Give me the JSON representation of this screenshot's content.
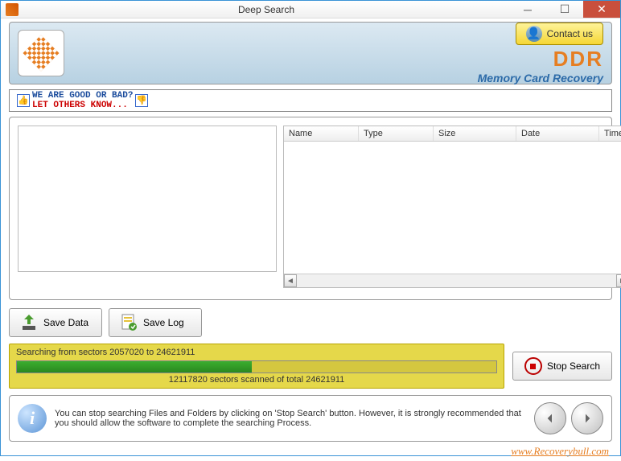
{
  "window": {
    "title": "Deep Search"
  },
  "header": {
    "contact_label": "Contact us",
    "brand": "DDR",
    "subtitle": "Memory Card Recovery"
  },
  "feedback": {
    "line1": "WE ARE GOOD OR BAD?",
    "line2": "LET OTHERS KNOW..."
  },
  "table": {
    "columns": [
      "Name",
      "Type",
      "Size",
      "Date",
      "Time"
    ]
  },
  "actions": {
    "save_data": "Save Data",
    "save_log": "Save Log",
    "stop_search": "Stop Search"
  },
  "progress": {
    "searching_line": "Searching from sectors  2057020 to 24621911",
    "scanned_line": "12117820  sectors scanned of total 24621911",
    "percent": 49
  },
  "info": {
    "text": "You can stop searching Files and Folders by clicking on 'Stop Search' button. However, it is strongly recommended that you should allow the software to complete the searching Process."
  },
  "footer": {
    "url": "www.Recoverybull.com"
  }
}
